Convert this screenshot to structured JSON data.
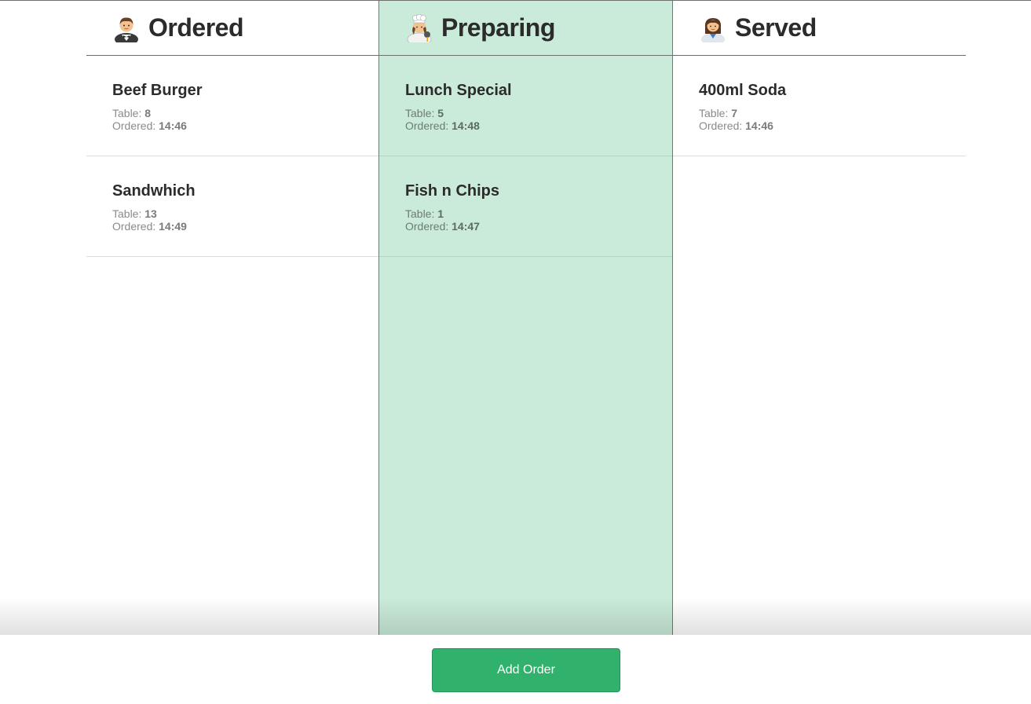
{
  "columns": [
    {
      "title": "Ordered",
      "icon": "waiter-icon",
      "orders": [
        {
          "name": "Beef Burger",
          "table_label": "Table:",
          "table": "8",
          "ordered_label": "Ordered:",
          "time": "14:46"
        },
        {
          "name": "Sandwhich",
          "table_label": "Table:",
          "table": "13",
          "ordered_label": "Ordered:",
          "time": "14:49"
        }
      ]
    },
    {
      "title": "Preparing",
      "icon": "cook-icon",
      "highlight_color": "#caebd9",
      "orders": [
        {
          "name": "Lunch Special",
          "table_label": "Table:",
          "table": "5",
          "ordered_label": "Ordered:",
          "time": "14:48"
        },
        {
          "name": "Fish n Chips",
          "table_label": "Table:",
          "table": "1",
          "ordered_label": "Ordered:",
          "time": "14:47"
        }
      ]
    },
    {
      "title": "Served",
      "icon": "office-worker-icon",
      "orders": [
        {
          "name": "400ml Soda",
          "table_label": "Table:",
          "table": "7",
          "ordered_label": "Ordered:",
          "time": "14:46"
        }
      ]
    }
  ],
  "footer": {
    "add_order_label": "Add Order",
    "button_color": "#30b26d"
  }
}
